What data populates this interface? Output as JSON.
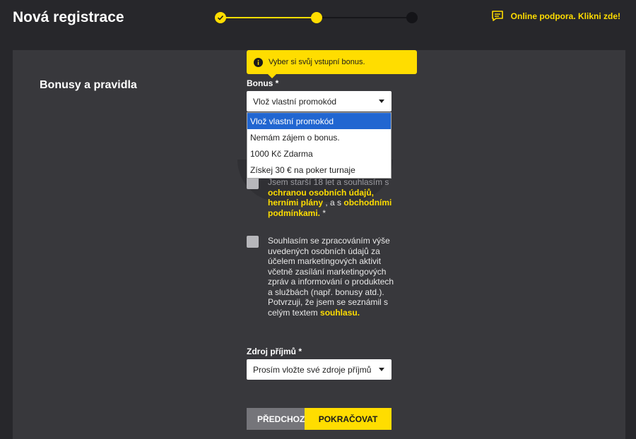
{
  "header": {
    "title": "Nová registrace",
    "support_label": "Online podpora. Klikni zde!"
  },
  "stepper": {
    "current_step": 2,
    "total_steps": 3
  },
  "section": {
    "title": "Bonusy a pravidla"
  },
  "tooltip": {
    "text": "Vyber si svůj vstupní bonus."
  },
  "bonus": {
    "label": "Bonus *",
    "selected": "Vlož vlastní promokód",
    "options": [
      "Vlož vlastní promokód",
      "Nemám zájem o bonus.",
      "1000 Kč Zdarma",
      "Získej 30 € na poker turnaje"
    ]
  },
  "consent_age": {
    "text_1": "Jsem starší 18 let a souhlasím s ",
    "link_privacy": "ochranou osobních údajů,",
    "link_gaming_plans": "herními plány",
    "text_2": " , a s ",
    "link_terms": "obchodními podmínkami.",
    "text_3": " *"
  },
  "consent_marketing": {
    "text_1": "Souhlasím se zpracováním výše uvedených osobních údajů za účelem marketingových aktivit včetně zasílání marketingových zpráv a informování o produktech a službách (např. bonusy atd.).",
    "text_2": "Potvrzuji, že jsem se seznámil s celým textem ",
    "link_consent": "souhlasu."
  },
  "income": {
    "label": "Zdroj příjmů *",
    "placeholder": "Prosím vložte své zdroje příjmů"
  },
  "buttons": {
    "prev": "PŘEDCHOZÍ",
    "next": "POKRAČOVAT"
  },
  "colors": {
    "accent": "#ffdd00",
    "background": "#27272b",
    "panel": "#38383c",
    "selected_option": "#2166d1"
  }
}
